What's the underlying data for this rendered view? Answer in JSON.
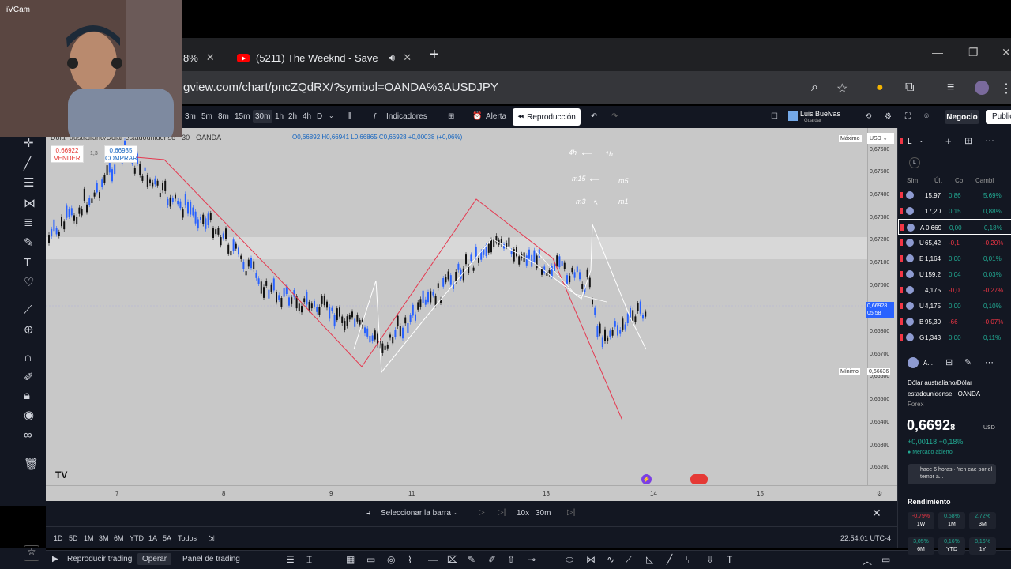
{
  "webcam": {
    "label": "iVCam"
  },
  "browser": {
    "active_tab_text": "8%",
    "youtube_tab_title": "(5211) The Weeknd - Save",
    "new_tab": "+",
    "url": "gview.com/chart/pncZQdRX/?symbol=OANDA%3AUSDJPY"
  },
  "toolbar": {
    "timeframes": [
      "3m",
      "5m",
      "8m",
      "15m",
      "30m",
      "1h",
      "2h",
      "4h",
      "D"
    ],
    "selected_timeframe": "30m",
    "indicators": "Indicadores",
    "alert": "Alerta",
    "replay": "Reproducción",
    "user_name": "Luis Buelvas",
    "user_sub": "Guardar",
    "trade_button": "Negocio",
    "publish_button": "Publicar"
  },
  "chart": {
    "symbol_line": "Dólar australiano/Dólar estadounidense · 30 · OANDA",
    "ohlc": "O0,66892 H0,66941 L0,66865 C0,66928 +0,00038 (+0,06%)",
    "sell_price": "0,66922",
    "sell_label": "VENDER",
    "spread": "1,3",
    "buy_price": "0,66935",
    "buy_label": "COMPRAR",
    "annotations": [
      {
        "text": "4h",
        "arrow": "1h"
      },
      {
        "text": "m15",
        "arrow": "m5"
      },
      {
        "text": "m3",
        "arrow": "m1"
      }
    ],
    "max_label": "Máximo",
    "min_label": "Mínimo",
    "min_value": "0,66636",
    "currency": "USD",
    "current_price": "0,66928",
    "countdown": "05:58",
    "price_labels": [
      "0,67600",
      "0,67500",
      "0,67400",
      "0,67300",
      "0,67200",
      "0,67100",
      "0,67000",
      "0,66800",
      "0,66700",
      "0,66600",
      "0,66500",
      "0,66400",
      "0,66300",
      "0,66200"
    ],
    "time_labels": [
      "7",
      "8",
      "9",
      "11",
      "13",
      "14",
      "15"
    ]
  },
  "replay_bar": {
    "select_bar": "Seleccionar la barra",
    "speed": "10x",
    "interval": "30m"
  },
  "ranges": [
    "1D",
    "5D",
    "1M",
    "3M",
    "6M",
    "YTD",
    "1A",
    "5A",
    "Todos"
  ],
  "clock": "22:54:01 UTC-4",
  "bottom": {
    "replay_trading": "Reproducir trading",
    "operate": "Operar",
    "trading_panel": "Panel de trading"
  },
  "watchlist": {
    "symbol_initial": "L",
    "headers": [
      "Sím",
      "Últ",
      "Cb",
      "Cambl"
    ],
    "rows": [
      {
        "sym": "",
        "last": "15,97",
        "chg": "0,86",
        "pct": "5,69%",
        "dir": "pos"
      },
      {
        "sym": "",
        "last": "17,20",
        "chg": "0,15",
        "pct": "0,88%",
        "dir": "pos"
      },
      {
        "sym": "A",
        "last": "0,669",
        "chg": "0,00",
        "pct": "0,18%",
        "dir": "pos"
      },
      {
        "sym": "U",
        "last": "65,42",
        "chg": "-0,1",
        "pct": "-0,20%",
        "dir": "neg"
      },
      {
        "sym": "E",
        "last": "1,164",
        "chg": "0,00",
        "pct": "0,01%",
        "dir": "pos"
      },
      {
        "sym": "U",
        "last": "159,2",
        "chg": "0,04",
        "pct": "0,03%",
        "dir": "pos"
      },
      {
        "sym": "",
        "last": "4,175",
        "chg": "-0,0",
        "pct": "-0,27%",
        "dir": "neg"
      },
      {
        "sym": "U",
        "last": "4,175",
        "chg": "0,00",
        "pct": "0,10%",
        "dir": "pos"
      },
      {
        "sym": "B",
        "last": "95,30",
        "chg": "-66",
        "pct": "-0,07%",
        "dir": "neg"
      },
      {
        "sym": "G",
        "last": "1,343",
        "chg": "0,00",
        "pct": "0,11%",
        "dir": "pos"
      }
    ]
  },
  "details": {
    "short": "A...",
    "name": "Dólar australiano/Dólar estadounidense · OANDA",
    "market": "Forex",
    "price": "0,6692",
    "price_small": "8",
    "currency": "USD",
    "change": "+0,00118  +0,18%",
    "status": "Mercado abierto",
    "news": "hace 6 horas · Yen cae por el temor a...",
    "performance_title": "Rendimiento",
    "performance": [
      {
        "value": "-0,79%",
        "label": "1W",
        "dir": "neg"
      },
      {
        "value": "0,58%",
        "label": "1M",
        "dir": "pos"
      },
      {
        "value": "2,72%",
        "label": "3M",
        "dir": "pos"
      },
      {
        "value": "3,05%",
        "label": "6M",
        "dir": "pos"
      },
      {
        "value": "0,16%",
        "label": "YTD",
        "dir": "pos"
      },
      {
        "value": "8,16%",
        "label": "1Y",
        "dir": "pos"
      }
    ]
  }
}
